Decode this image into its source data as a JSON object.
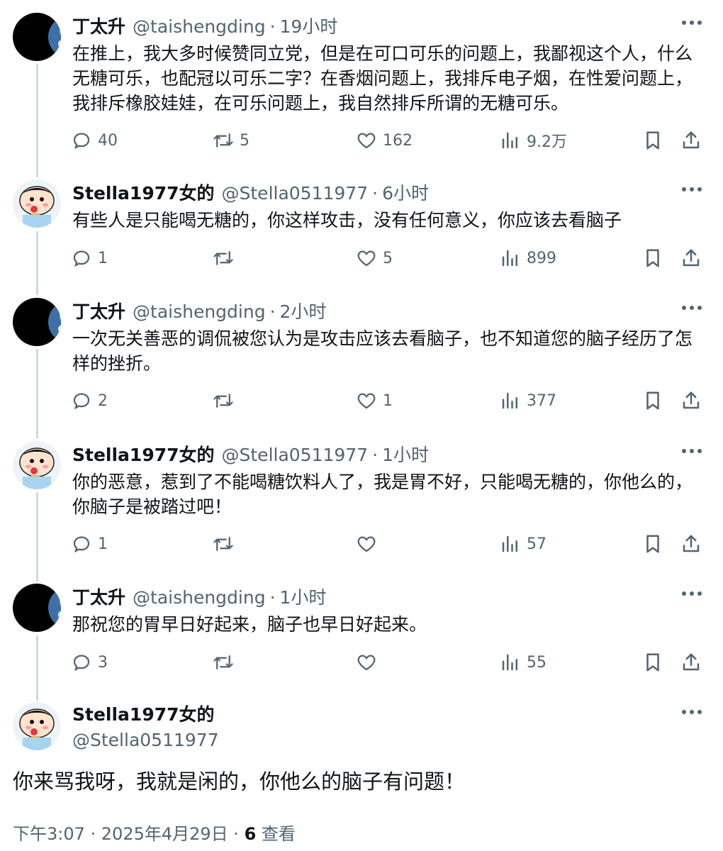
{
  "tweets": [
    {
      "name": "丁太升",
      "handle": "@taishengding",
      "time": "19小时",
      "text": "在推上，我大多时候赞同立党，但是在可口可乐的问题上，我鄙视这个人，什么无糖可乐，也配冠以可乐二字？在香烟问题上，我排斥电子烟，在性爱问题上，我排斥橡胶娃娃，在可乐问题上，我自然排斥所谓的无糖可乐。",
      "replies": "40",
      "retweets": "5",
      "likes": "162",
      "views": "9.2万"
    },
    {
      "name": "Stella1977女的",
      "handle": "@Stella0511977",
      "time": "6小时",
      "text": "有些人是只能喝无糖的，你这样攻击，没有任何意义，你应该去看脑子",
      "replies": "1",
      "retweets": "",
      "likes": "5",
      "views": "899"
    },
    {
      "name": "丁太升",
      "handle": "@taishengding",
      "time": "2小时",
      "text": "一次无关善恶的调侃被您认为是攻击应该去看脑子，也不知道您的脑子经历了怎样的挫折。",
      "replies": "2",
      "retweets": "",
      "likes": "1",
      "views": "377"
    },
    {
      "name": "Stella1977女的",
      "handle": "@Stella0511977",
      "time": "1小时",
      "text": "你的恶意，惹到了不能喝糖饮料人了，我是胃不好，只能喝无糖的，你他么的，你脑子是被踏过吧！",
      "replies": "1",
      "retweets": "",
      "likes": "",
      "views": "57"
    },
    {
      "name": "丁太升",
      "handle": "@taishengding",
      "time": "1小时",
      "text": "那祝您的胃早日好起来，脑子也早日好起来。",
      "replies": "3",
      "retweets": "",
      "likes": "",
      "views": "55"
    }
  ],
  "main_tweet": {
    "name": "Stella1977女的",
    "handle": "@Stella0511977",
    "text": "你来骂我呀，我就是闲的，你他么的脑子有问题！",
    "timestamp": "下午3:07 · 2025年4月29日 · ",
    "view_count": "6",
    "view_label": " 查看"
  },
  "separator": "·",
  "icons": [
    "reply-icon",
    "retweet-icon",
    "like-icon",
    "views-icon",
    "bookmark-icon",
    "share-icon",
    "more-icon"
  ],
  "colors": {
    "text": "#0f1419",
    "secondary": "#536471",
    "thread_line": "#cfd9de"
  }
}
